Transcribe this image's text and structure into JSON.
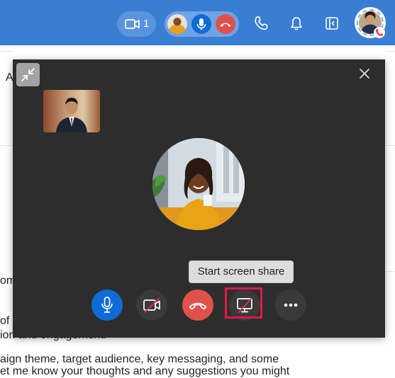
{
  "topbar": {
    "video_participants_count": "1",
    "icons": [
      "video-camera-icon",
      "microphone-icon",
      "hang-up-icon",
      "phone-icon",
      "bell-icon",
      "side-panel-icon"
    ],
    "colors": {
      "bar": "#3a7ed3",
      "mic": "#0f6cd6",
      "end_call": "#e0514b"
    }
  },
  "background_page": {
    "lines": [
      {
        "text": "A"
      },
      {
        "text": "om"
      },
      {
        "text": "of"
      },
      {
        "text": "ion and engagement."
      },
      {
        "text": "aign theme, target audience, key messaging, and some"
      },
      {
        "text": "et me know your thoughts and any suggestions you might"
      }
    ]
  },
  "call_window": {
    "tooltip": "Start screen share",
    "controls": [
      {
        "name": "microphone",
        "state": "on",
        "color": "#0f6cd6"
      },
      {
        "name": "camera",
        "state": "off"
      },
      {
        "name": "end-call",
        "color": "#e0514b"
      },
      {
        "name": "screen-share",
        "state": "off",
        "highlighted": true
      },
      {
        "name": "more-options"
      }
    ],
    "highlight_color": "#e2194a"
  }
}
